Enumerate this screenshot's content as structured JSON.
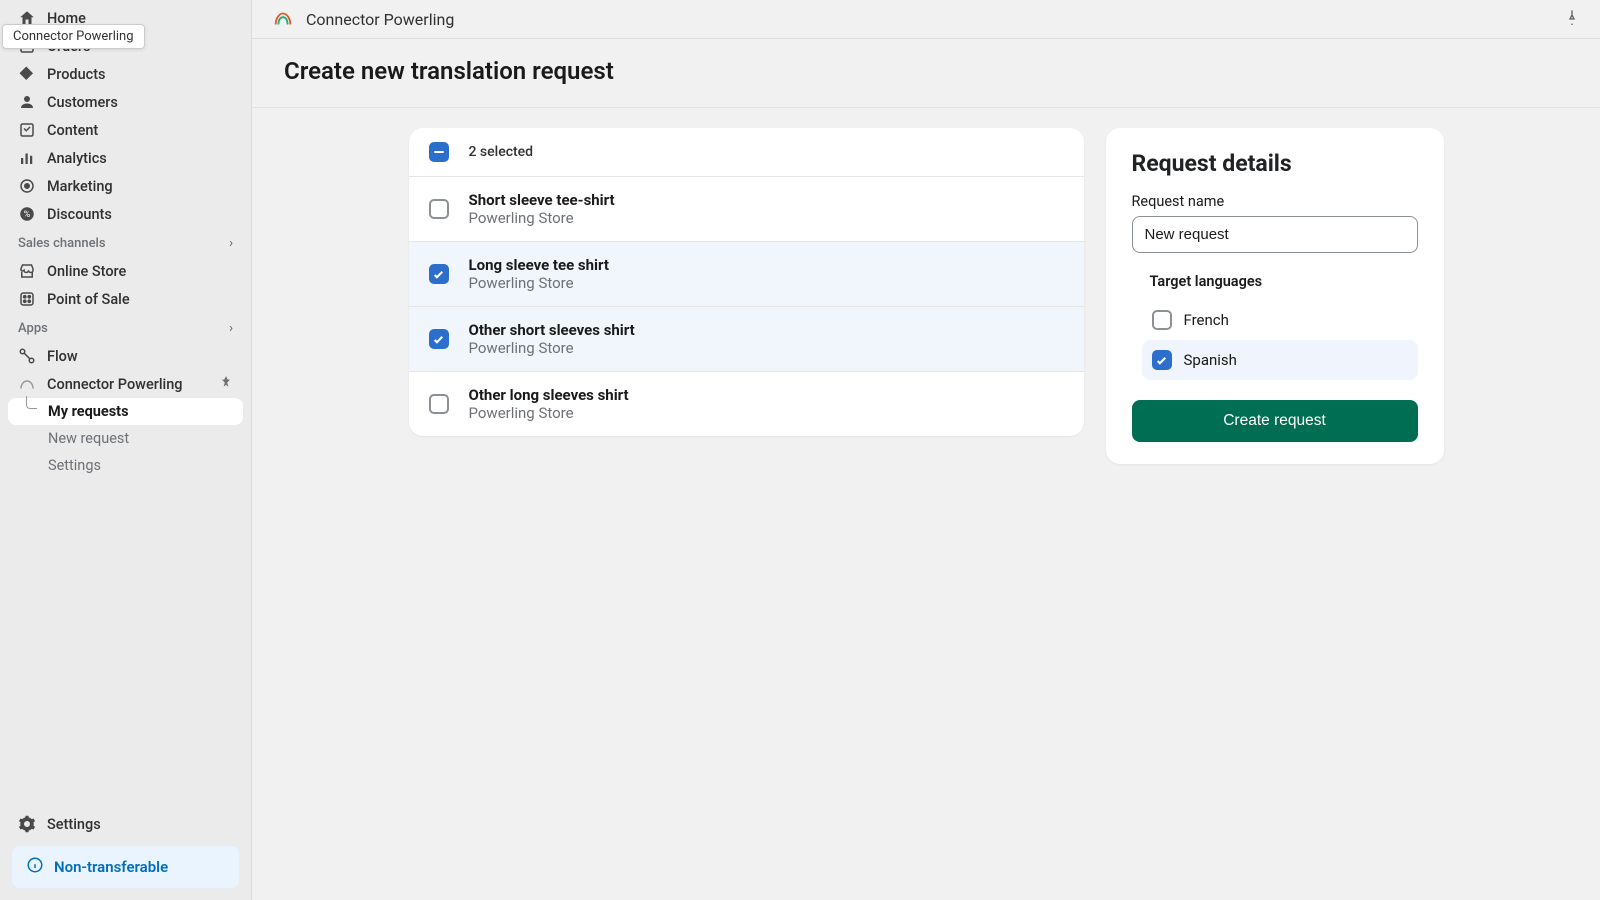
{
  "sidebar": {
    "tooltip": "Connector Powerling",
    "main": [
      {
        "icon": "home",
        "label": "Home"
      },
      {
        "icon": "orders",
        "label": "Orders"
      },
      {
        "icon": "products",
        "label": "Products"
      },
      {
        "icon": "customers",
        "label": "Customers"
      },
      {
        "icon": "content",
        "label": "Content"
      },
      {
        "icon": "analytics",
        "label": "Analytics"
      },
      {
        "icon": "marketing",
        "label": "Marketing"
      },
      {
        "icon": "discounts",
        "label": "Discounts"
      }
    ],
    "channels_header": "Sales channels",
    "channels": [
      {
        "icon": "store",
        "label": "Online Store"
      },
      {
        "icon": "pos",
        "label": "Point of Sale"
      }
    ],
    "apps_header": "Apps",
    "apps": [
      {
        "icon": "flow",
        "label": "Flow"
      },
      {
        "icon": "connector",
        "label": "Connector Powerling",
        "pinned": true
      }
    ],
    "app_sub": [
      {
        "label": "My requests",
        "active": true
      },
      {
        "label": "New request",
        "active": false
      },
      {
        "label": "Settings",
        "active": false
      }
    ],
    "settings_label": "Settings",
    "badge": "Non-transferable"
  },
  "topbar": {
    "title": "Connector Powerling"
  },
  "page": {
    "title": "Create new translation request"
  },
  "products": {
    "selected_count": "2 selected",
    "items": [
      {
        "title": "Short sleeve tee-shirt",
        "store": "Powerling Store",
        "checked": false
      },
      {
        "title": "Long sleeve tee shirt",
        "store": "Powerling Store",
        "checked": true
      },
      {
        "title": "Other short sleeves shirt",
        "store": "Powerling Store",
        "checked": true
      },
      {
        "title": "Other long sleeves shirt",
        "store": "Powerling Store",
        "checked": false
      }
    ]
  },
  "details": {
    "title": "Request details",
    "name_label": "Request name",
    "name_value": "New request",
    "langs_label": "Target languages",
    "langs": [
      {
        "label": "French",
        "checked": false
      },
      {
        "label": "Spanish",
        "checked": true
      }
    ],
    "create_btn": "Create request"
  }
}
